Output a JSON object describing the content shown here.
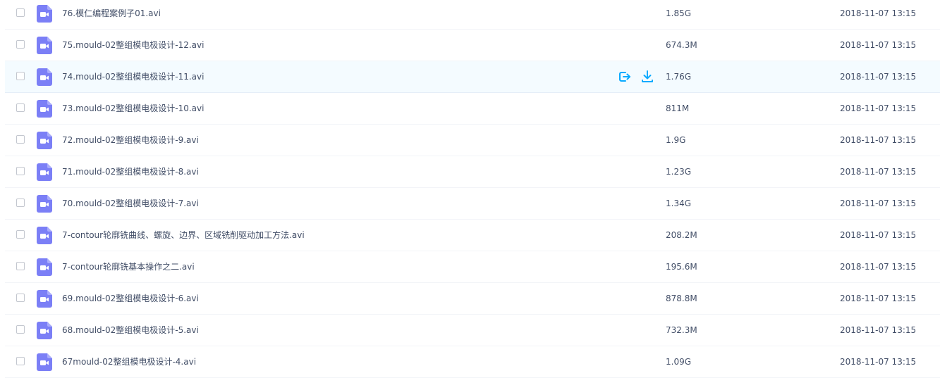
{
  "colors": {
    "video_icon": "#7b7ff6",
    "action_icon": "#09aaff",
    "hover_row": "#f4fbff",
    "text": "#424e67"
  },
  "row_icon": "video-file-icon",
  "files": [
    {
      "name": "76.模仁编程案例子01.avi",
      "size": "1.85G",
      "time": "2018-11-07 13:15"
    },
    {
      "name": "75.mould-02整组模电极设计-12.avi",
      "size": "674.3M",
      "time": "2018-11-07 13:15"
    },
    {
      "name": "74.mould-02整组模电极设计-11.avi",
      "size": "1.76G",
      "time": "2018-11-07 13:15",
      "hover": true
    },
    {
      "name": "73.mould-02整组模电极设计-10.avi",
      "size": "811M",
      "time": "2018-11-07 13:15"
    },
    {
      "name": "72.mould-02整组模电极设计-9.avi",
      "size": "1.9G",
      "time": "2018-11-07 13:15"
    },
    {
      "name": "71.mould-02整组模电极设计-8.avi",
      "size": "1.23G",
      "time": "2018-11-07 13:15"
    },
    {
      "name": "70.mould-02整组模电极设计-7.avi",
      "size": "1.34G",
      "time": "2018-11-07 13:15"
    },
    {
      "name": "7-contour轮廓铣曲线、螺旋、边界、区域铣削驱动加工方法.avi",
      "size": "208.2M",
      "time": "2018-11-07 13:15"
    },
    {
      "name": "7-contour轮廓铣基本操作之二.avi",
      "size": "195.6M",
      "time": "2018-11-07 13:15"
    },
    {
      "name": "69.mould-02整组模电极设计-6.avi",
      "size": "878.8M",
      "time": "2018-11-07 13:15"
    },
    {
      "name": "68.mould-02整组模电极设计-5.avi",
      "size": "732.3M",
      "time": "2018-11-07 13:15"
    },
    {
      "name": "67mould-02整组模电极设计-4.avi",
      "size": "1.09G",
      "time": "2018-11-07 13:15"
    }
  ]
}
